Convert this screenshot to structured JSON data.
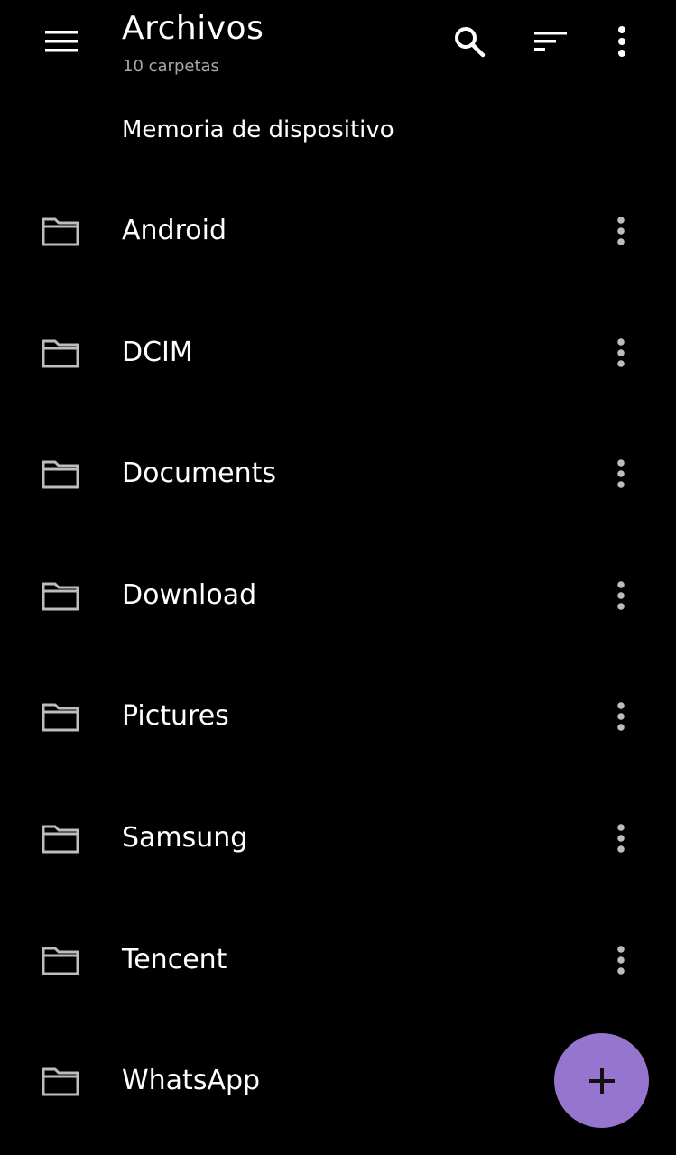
{
  "toolbar": {
    "title": "Archivos",
    "subtitle": "10 carpetas",
    "menu_icon": "menu-icon",
    "search_icon": "search-icon",
    "sort_icon": "sort-icon",
    "overflow_icon": "more-vert-icon"
  },
  "section": {
    "header": "Memoria de dispositivo"
  },
  "folders": [
    {
      "label": "Android"
    },
    {
      "label": "DCIM"
    },
    {
      "label": "Documents"
    },
    {
      "label": "Download"
    },
    {
      "label": "Pictures"
    },
    {
      "label": "Samsung"
    },
    {
      "label": "Tencent"
    },
    {
      "label": "WhatsApp"
    }
  ],
  "fab": {
    "icon": "add-icon",
    "color": "#9575cd"
  },
  "colors": {
    "background": "#000000",
    "text": "#ffffff",
    "secondary_text": "#a8a8a8",
    "icon": "#bdbdbd",
    "accent": "#9575cd"
  }
}
